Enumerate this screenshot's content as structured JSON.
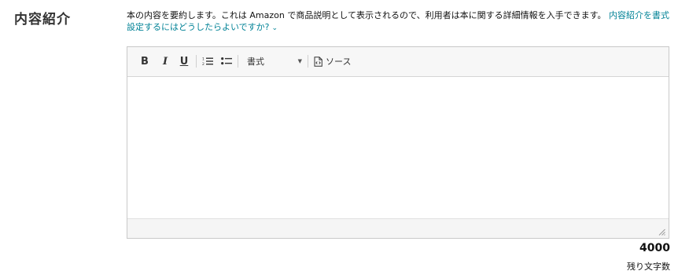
{
  "section": {
    "title": "内容紹介"
  },
  "description": {
    "text": "本の内容を要約します。これは Amazon で商品説明として表示されるので、利用者は本に関する詳細情報を入手できます。",
    "link_text": "内容紹介を書式設定するにはどうしたらよいですか?",
    "link_icon": "chevron-down-icon"
  },
  "toolbar": {
    "bold_label": "B",
    "italic_label": "I",
    "underline_label": "U",
    "ordered_list_icon": "ordered-list-icon",
    "bullet_list_icon": "bullet-list-icon",
    "format_label": "書式",
    "source_label": "ソース",
    "source_icon": "source-code-icon"
  },
  "editor": {
    "value": ""
  },
  "counter": {
    "remaining": "4000",
    "label": "残り文字数"
  },
  "colors": {
    "link": "#008296",
    "border": "#c9c9c9",
    "toolbar_bg": "#f7f7f7"
  }
}
